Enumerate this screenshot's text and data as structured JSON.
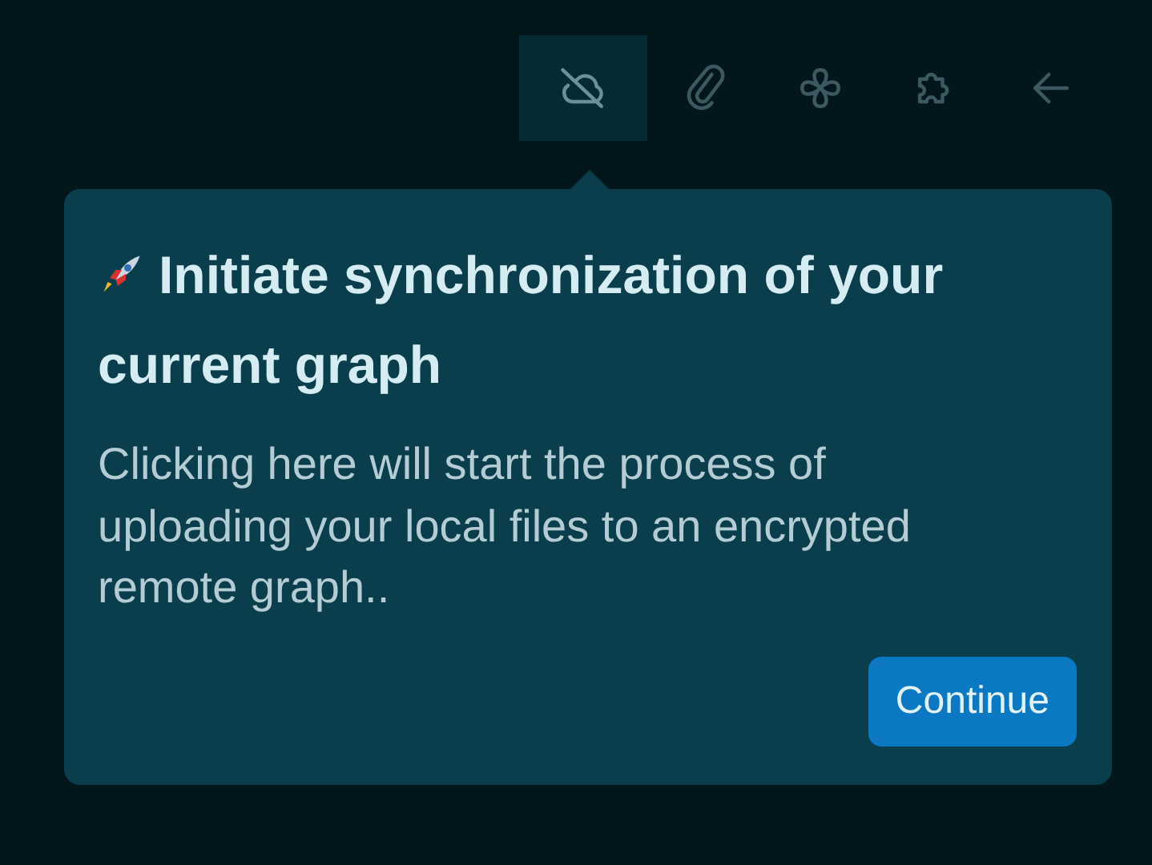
{
  "toolbar": {
    "buttons": [
      {
        "kind": "cloud-off",
        "selected": true
      },
      {
        "kind": "paperclip",
        "selected": false
      },
      {
        "kind": "flower",
        "selected": false
      },
      {
        "kind": "puzzle",
        "selected": false
      },
      {
        "kind": "arrow-left",
        "selected": false
      }
    ]
  },
  "popover": {
    "title_lines": [
      "Initiate synchronization of your",
      "current graph"
    ],
    "body": "Clicking here will start the process of uploading your local files to an encrypted remote graph..",
    "button": "Continue"
  }
}
